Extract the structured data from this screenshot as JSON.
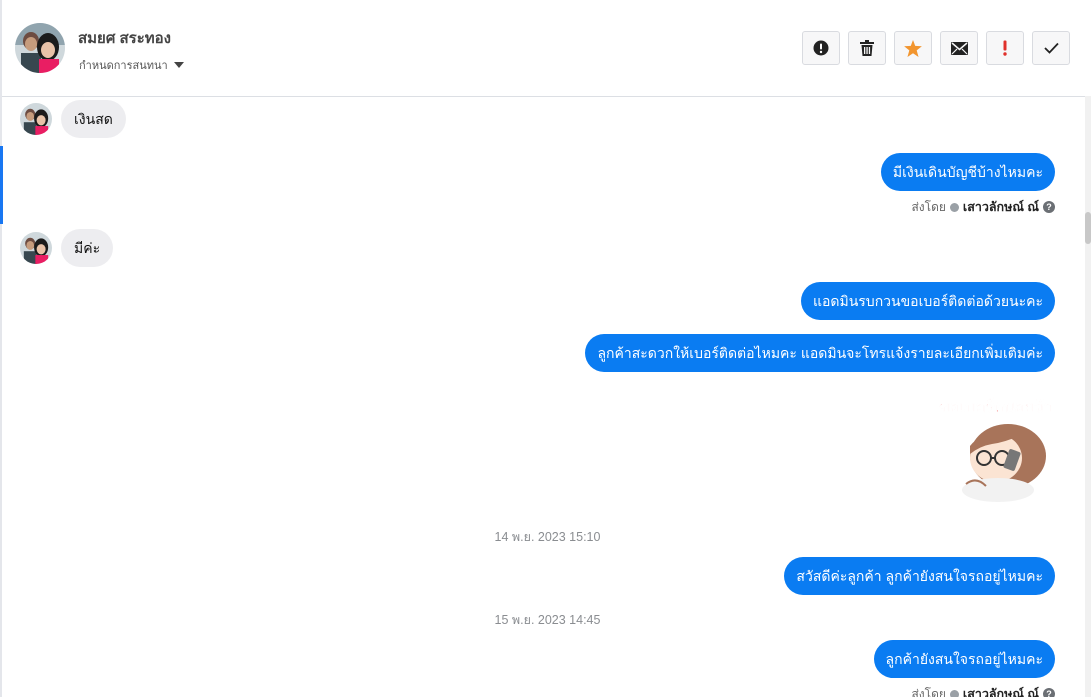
{
  "header": {
    "contact_name": "สมยศ สระทอง",
    "conversation_setting": "กำหนดการสนทนา",
    "toolbar": [
      {
        "name": "report-button",
        "icon": "exclamation-circle-icon"
      },
      {
        "name": "delete-button",
        "icon": "trash-icon"
      },
      {
        "name": "star-button",
        "icon": "star-icon"
      },
      {
        "name": "mark-unread-button",
        "icon": "envelope-icon"
      },
      {
        "name": "important-button",
        "icon": "exclamation-icon"
      },
      {
        "name": "done-button",
        "icon": "check-icon"
      }
    ]
  },
  "messages": {
    "m1": "เงินสด",
    "m2": "มีเงินเดินบัญชีบ้างไหมคะ",
    "m3": "มีค่ะ",
    "m4": "แอดมินรบกวนขอเบอร์ติดต่อด้วยนะคะ",
    "m5": "ลูกค้าสะดวกให้เบอร์ติดต่อไหมคะ แอดมินจะโทรแจ้งรายละเอียกเพิ่มเติมค่ะ",
    "m6": "สวัสดีค่ะลูกค้า ลูกค้ายังสนใจรถอยู่ไหมคะ",
    "m7": "ลูกค้ายังสนใจรถอยู่ไหมคะ"
  },
  "sent_by": {
    "label": "ส่งโดย",
    "agent": "เสาวลักษณ์ ณ์",
    "help": "?"
  },
  "sticker": {
    "text": "ขอเบอร์หน่อยจ้า",
    "icon": "girl-phone-sticker-icon"
  },
  "timestamps": {
    "t1": "14 พ.ย. 2023 15:10",
    "t2": "15 พ.ย. 2023 14:45"
  },
  "colors": {
    "outgoing_bubble": "#0a7cf2",
    "incoming_bubble": "#ededf0",
    "star": "#f2952e",
    "important": "#e0302b"
  }
}
